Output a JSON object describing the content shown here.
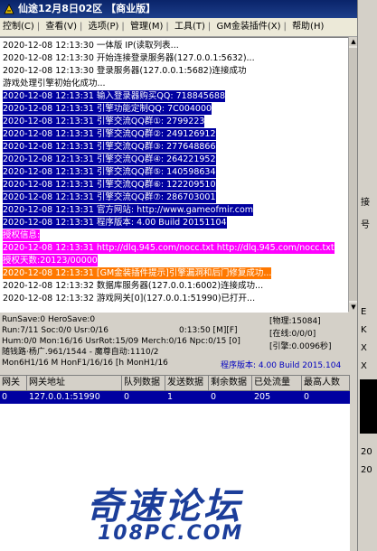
{
  "window": {
    "title": "仙途12月8日02区 【商业版】"
  },
  "menu": [
    "控制(C)",
    "查看(V)",
    "选项(P)",
    "管理(M)",
    "工具(T)",
    "GM金装插件(X)",
    "帮助(H)"
  ],
  "log": [
    {
      "text": "2020-12-08 12:13:30 一体版 IP(读取列表...",
      "style": "normal"
    },
    {
      "text": "2020-12-08 12:13:30 开始连接登录服务器(127.0.0.1:5632)...",
      "style": "normal"
    },
    {
      "text": "2020-12-08 12:13:30 登录服务器(127.0.0.1:5682)连接成功",
      "style": "normal"
    },
    {
      "text": "游戏处理引擎初始化成功...",
      "style": "normal"
    },
    {
      "text": "2020-12-08 12:13:31 输入登录器购买QQ: 718845688",
      "style": "blue"
    },
    {
      "text": "2020-12-08 12:13:31 引擎功能定制QQ: 7C004000",
      "style": "blue"
    },
    {
      "text": "2020-12-08 12:13:31 引擎交流QQ群①: 2799223",
      "style": "blue"
    },
    {
      "text": "2020-12-08 12:13:31 引擎交流QQ群②: 249126912",
      "style": "blue"
    },
    {
      "text": "2020-12-08 12:13:31 引擎交流QQ群③: 277648866",
      "style": "blue"
    },
    {
      "text": "2020-12-08 12:13:31 引擎交流QQ群④: 264221952",
      "style": "blue"
    },
    {
      "text": "2020-12-08 12:13:31 引擎交流QQ群⑤: 140598634",
      "style": "blue"
    },
    {
      "text": "2020-12-08 12:13:31 引擎交流QQ群⑥: 122209510",
      "style": "blue"
    },
    {
      "text": "2020-12-08 12:13:31 引擎交流QQ群⑦: 286703001",
      "style": "blue"
    },
    {
      "text": "2020-12-08 12:13:31 官方网站: http://www.gameofmir.com",
      "style": "blue"
    },
    {
      "text": "2020-12-08 12:13:31 程序版本: 4.00 Build 20151104",
      "style": "blue"
    },
    {
      "text": "授权信息:",
      "style": "magenta"
    },
    {
      "text": "2020-12-08 12:13:31 http://dlq.945.com/nocc.txt http://dlq.945.com/nocc.txt",
      "style": "magenta"
    },
    {
      "text": "授权天数:20123/00000",
      "style": "magenta"
    },
    {
      "text": "2020-12-08 12:13:31 [GM金装插件提示]引擎漏洞和后门修复成功...",
      "style": "orange"
    },
    {
      "text": "2020-12-08 12:13:32 数据库服务器(127.0.0.1:6002)连接成功...",
      "style": "normal"
    },
    {
      "text": "2020-12-08 12:13:32 游戏网关[0](127.0.0.1:51990)已打开...",
      "style": "normal"
    }
  ],
  "status": {
    "line1": "RunSave:0 HeroSave:0",
    "line2": "Run:7/11 Soc:0/0 Usr:0/16",
    "line2b": "0:13:50 [M][F]",
    "line3": "Hum:0/0 Mon:16/16 UsrRot:15/09 Merch:0/16 Npc:0/15 [0]",
    "line4": "随钱路·杨广.961/1544 - 魔尊自动:1110/2",
    "line5": "Mon6H1/16 M HonF1/16/16 [h MonH1/16",
    "box1": "[物理:15084]",
    "box2": "[在线:0/0/0]",
    "box3": "[引擎:0.0096秒]",
    "version": "程序版本: 4.00 Build 2015.104"
  },
  "table": {
    "headers": [
      "网关",
      "网关地址",
      "队列数据",
      "发送数据",
      "剩余数据",
      "已处流量",
      "最高人数"
    ],
    "rows": [
      [
        "0",
        "127.0.0.1:51990",
        "0",
        "1",
        "0",
        "205",
        "0"
      ]
    ]
  },
  "watermark": {
    "line1": "奇速论坛",
    "line2": "108PC.COM"
  },
  "side_panel": {
    "items": [
      "接",
      "号",
      "E",
      "K",
      "X",
      "X",
      "20",
      "20"
    ]
  }
}
